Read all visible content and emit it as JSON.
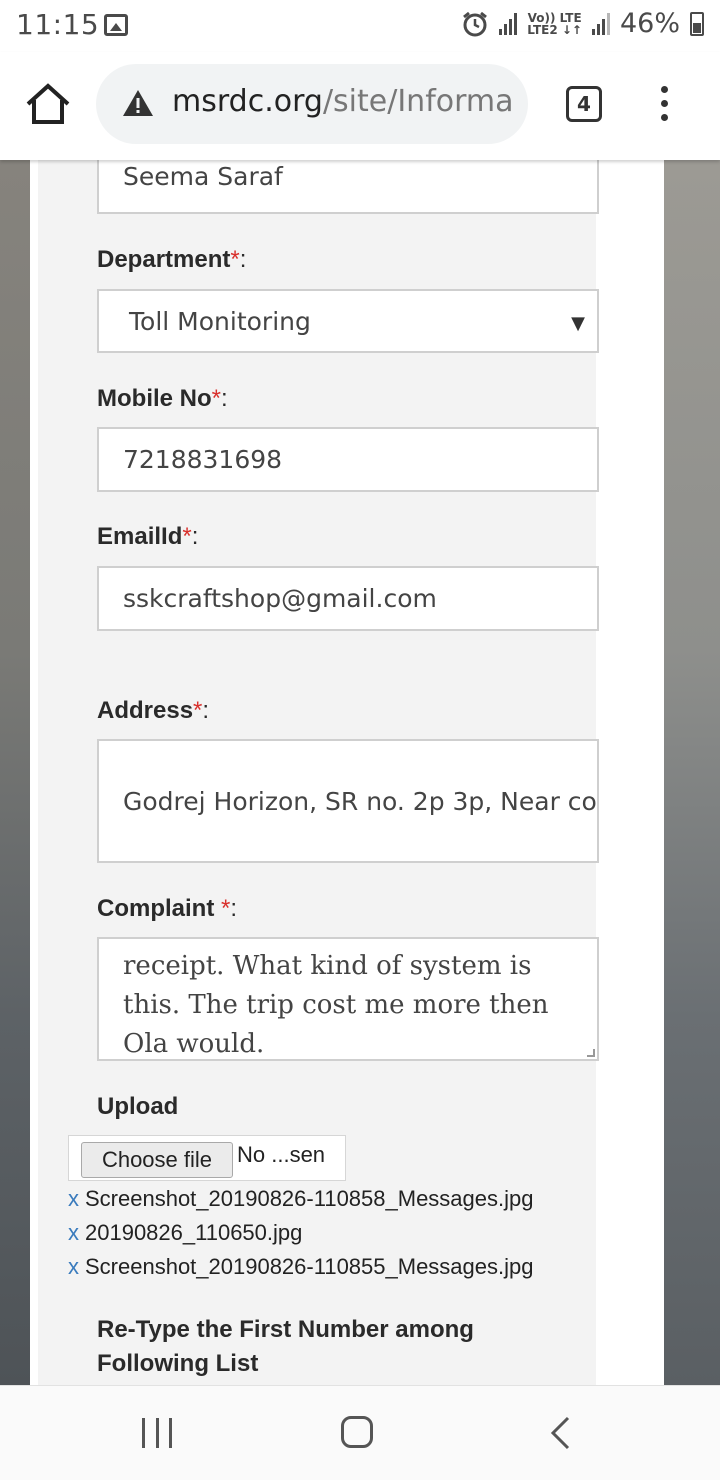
{
  "status_bar": {
    "time": "11:15",
    "network_top": "Vo)) LTE",
    "network_bottom": "LTE2 ↓↑",
    "battery": "46%"
  },
  "browser": {
    "url_host": "msrdc.org",
    "url_path": "/site/Informa",
    "tab_count": "4"
  },
  "form": {
    "name_value": "Seema Saraf",
    "department": {
      "label": "Department",
      "required": "*",
      "colon": ":",
      "value": "Toll Monitoring"
    },
    "mobile": {
      "label": "Mobile No",
      "required": "*",
      "colon": ":",
      "value": "7218831698"
    },
    "email": {
      "label": "EmailId",
      "required": "*",
      "colon": ":",
      "value": "sskcraftshop@gmail.com"
    },
    "address": {
      "label": "Address",
      "required": "*",
      "colon": ":",
      "value": "Godrej Horizon, SR no. 2p 3p, Near co"
    },
    "complaint": {
      "label": "Complaint ",
      "required": "*",
      "colon": ":",
      "lines": [
        "receipt. What kind of system is",
        "this. The trip cost me more then",
        "Ola would."
      ]
    },
    "upload": {
      "label": "Upload",
      "choose_button": "Choose file",
      "status": "No ...sen",
      "remove_symbol": "x",
      "files": [
        "Screenshot_20190826-110858_Messages.jpg",
        "20190826_110650.jpg",
        "Screenshot_20190826-110855_Messages.jpg"
      ]
    },
    "retype_label": "Re-Type the First Number among Following List"
  },
  "colors": {
    "required": "#d9302c",
    "remove_link": "#3a7bbd",
    "panel": "#f3f3f3"
  }
}
